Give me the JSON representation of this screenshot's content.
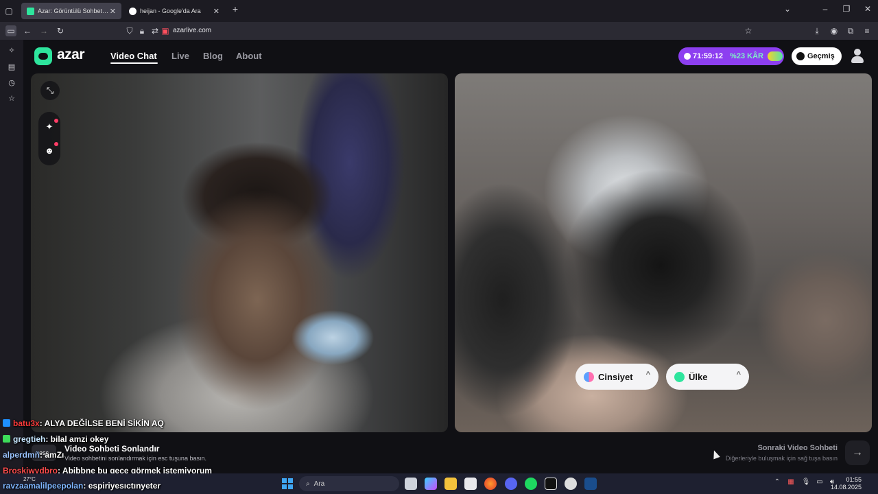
{
  "browser": {
    "tabs": [
      {
        "title": "Azar: Görüntülü Sohbet, Ar",
        "active": true
      },
      {
        "title": "heijan - Google'da Ara",
        "active": false
      }
    ],
    "new_tab": "+",
    "url": "azarlive.com"
  },
  "site": {
    "brand": "azar",
    "nav": [
      "Video Chat",
      "Live",
      "Blog",
      "About"
    ],
    "promo": {
      "timer": "71:59:12",
      "discount": "%23 KÂR"
    },
    "history_label": "Geçmiş"
  },
  "filters": [
    {
      "label": "Cinsiyet",
      "chevron": "^"
    },
    {
      "label": "Ülke",
      "chevron": "^"
    }
  ],
  "bottom": {
    "esc_key": "esc",
    "end_title": "Video Sohbeti Sonlandır",
    "end_sub": "Video sohbetini sonlandırmak için esc tuşuna basın.",
    "next_title": "Sonraki Video Sohbeti",
    "next_sub": "Diğerleriyle buluşmak için sağ tuşa basın",
    "next_arrow": "→"
  },
  "chat": [
    {
      "user": "batu3x",
      "text": ": ALYA DEĞİLSE BENİ SİKİN AQ",
      "color": "#ff3b3b",
      "badge": "#1e90ff"
    },
    {
      "user": "gregtieh",
      "text": ": bilal amzi okey",
      "color": "#c7e6ff",
      "badge": "#3ddc5a"
    },
    {
      "user": "alperdmñ",
      "text": ": amZı",
      "color": "#9bc4ff",
      "badge": ""
    },
    {
      "user": "Broskiwydbro",
      "text": ": Abibbne bu gece görmek istemiyorum",
      "color": "#ff4d4d",
      "badge": ""
    },
    {
      "user": "ravzaamalilpeepolan",
      "text": ": espiriyesıctınyeter",
      "color": "#7fb6ff",
      "badge": ""
    }
  ],
  "taskbar": {
    "weather": "27°C",
    "search_placeholder": "Ara",
    "time": "01:55",
    "date": "14.08.2025"
  }
}
